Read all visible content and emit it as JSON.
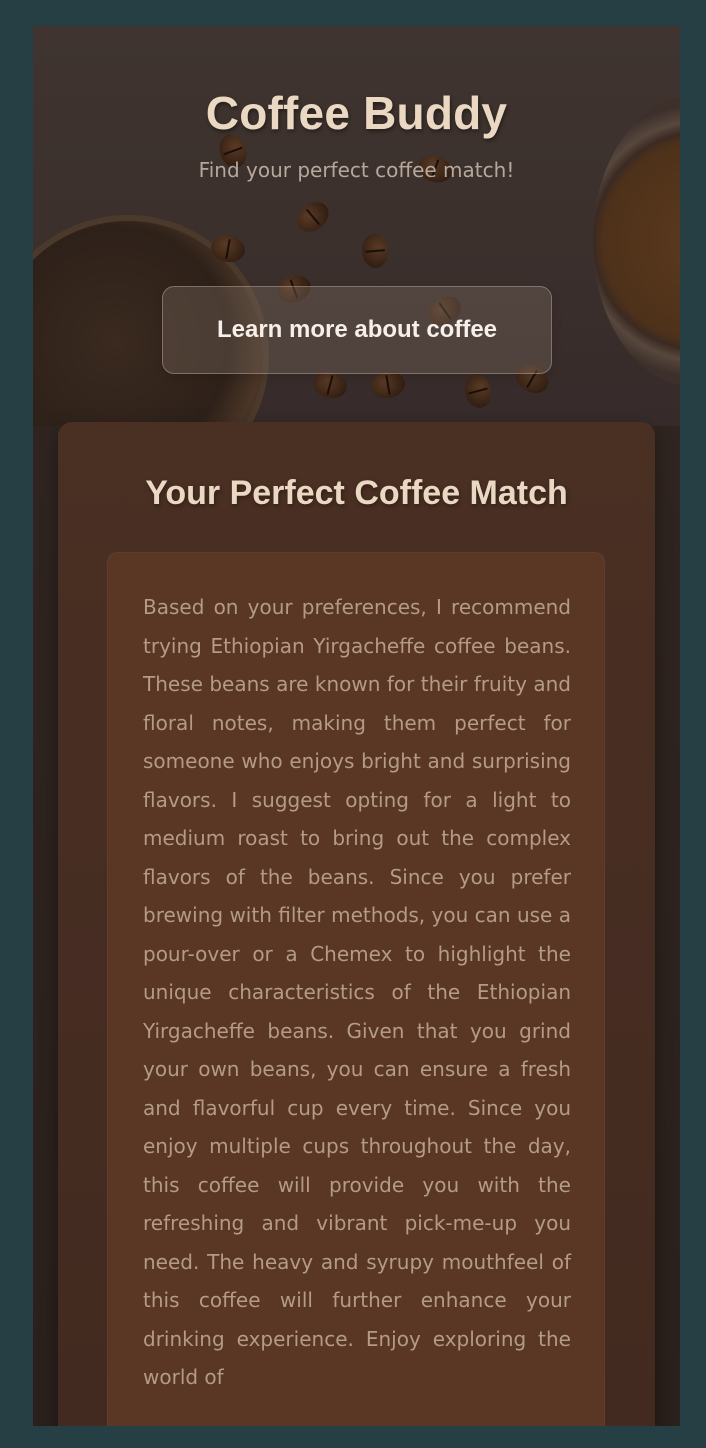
{
  "app": {
    "title": "Coffee Buddy",
    "subtitle": "Find your perfect coffee match!"
  },
  "actions": {
    "learn_more_label": "Learn more about coffee"
  },
  "match": {
    "heading": "Your Perfect Coffee Match",
    "recommendation": "Based on your preferences, I recommend trying Ethiopian Yirgacheffe coffee beans. These beans are known for their fruity and floral notes, making them perfect for someone who enjoys bright and surprising flavors. I suggest opting for a light to medium roast to bring out the complex flavors of the beans. Since you prefer brewing with filter methods, you can use a pour-over or a Chemex to highlight the unique characteristics of the Ethiopian Yirgacheffe beans. Given that you grind your own beans, you can ensure a fresh and flavorful cup every time. Since you enjoy multiple cups throughout the day, this coffee will provide you with the refreshing and vibrant pick-me-up you need. The heavy and syrupy mouthfeel of this coffee will further enhance your drinking experience. Enjoy exploring the world of"
  },
  "colors": {
    "page_background": "#263f45",
    "title_text": "#ead8c3",
    "card_background": "#4a2f23",
    "recommendation_box": "#5a3725",
    "recommendation_text": "#b39b86"
  }
}
